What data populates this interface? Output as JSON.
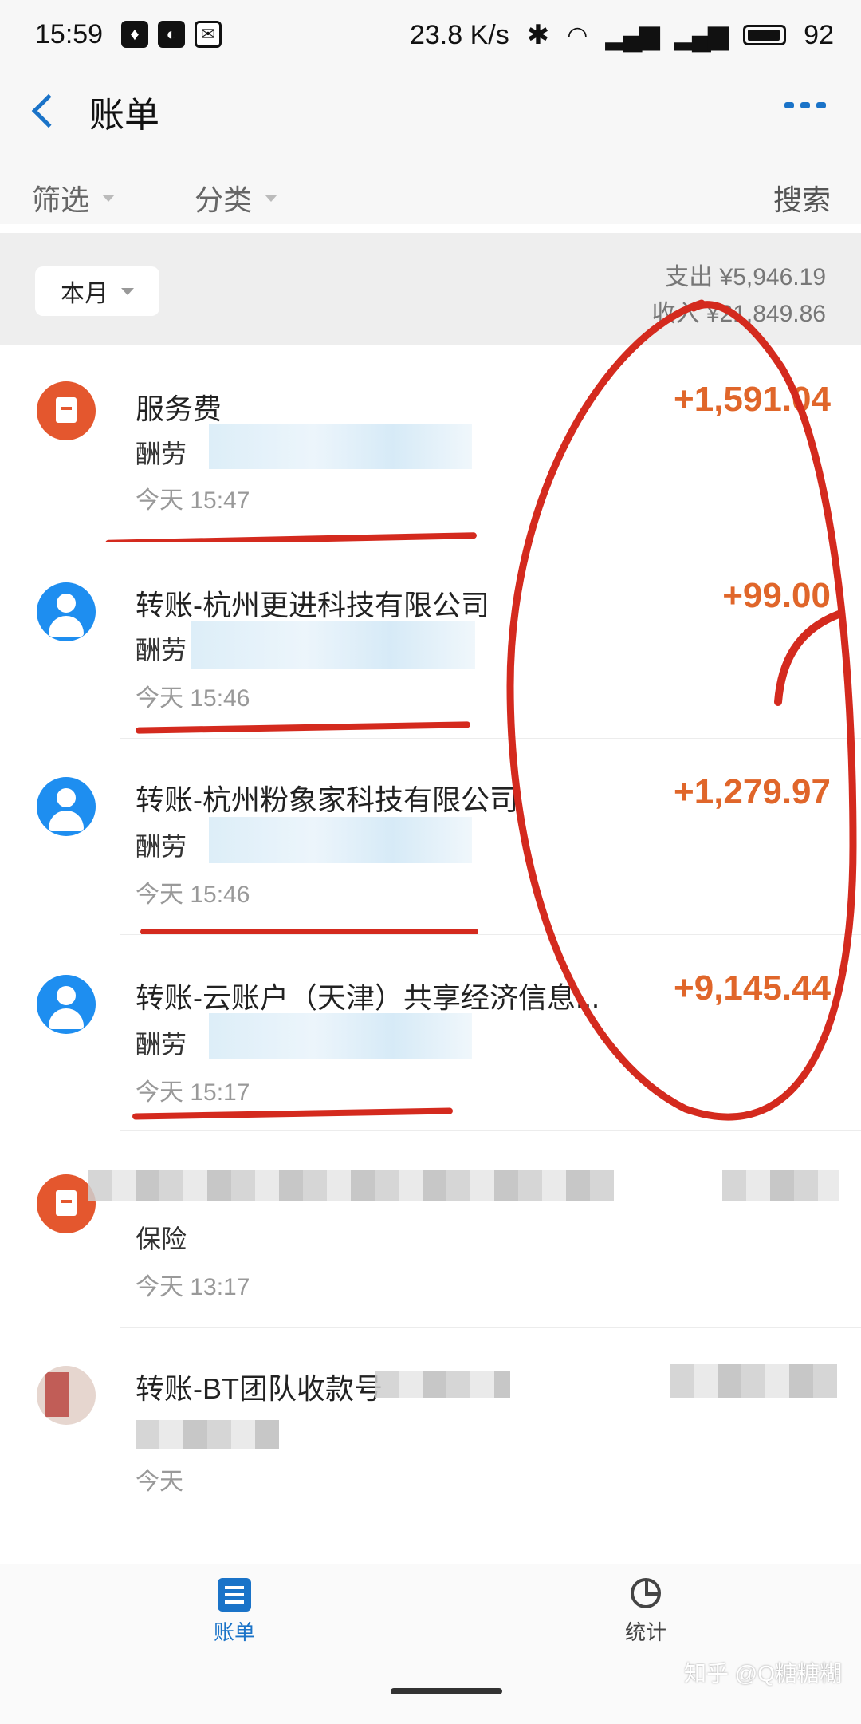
{
  "status_bar": {
    "time": "15:59",
    "icons": [
      "shield-icon",
      "app-icon",
      "chat-icon"
    ],
    "net_speed": "23.8 K/s",
    "battery": "92"
  },
  "header": {
    "title": "账单"
  },
  "filters": {
    "filter_label": "筛选",
    "category_label": "分类",
    "search_label": "搜索"
  },
  "summary": {
    "period": "本月",
    "expense": "支出 ¥5,946.19",
    "income": "收入 ¥21,849.86"
  },
  "transactions": [
    {
      "title": "服务费",
      "subtitle": "酬劳",
      "time": "今天  15:47",
      "amount": "+1,591.04",
      "icon": "red-envelope-icon"
    },
    {
      "title": "转账-杭州更进科技有限公司",
      "subtitle": "酬劳",
      "time": "今天  15:46",
      "amount": "+99.00",
      "icon": "user-icon"
    },
    {
      "title": "转账-杭州粉象家科技有限公司",
      "subtitle": "酬劳",
      "time": "今天  15:46",
      "amount": "+1,279.97",
      "icon": "user-icon"
    },
    {
      "title": "转账-云账户（天津）共享经济信息...",
      "subtitle": "酬劳",
      "time": "今天  15:17",
      "amount": "+9,145.44",
      "icon": "user-icon"
    },
    {
      "title": "",
      "subtitle": "保险",
      "time": "今天  13:17",
      "amount": "",
      "icon": "shop-icon"
    },
    {
      "title": "转账-BT团队收款号",
      "subtitle": "",
      "time": "今天",
      "amount": "",
      "icon": "photo-avatar"
    }
  ],
  "bottom_nav": {
    "bill_label": "账单",
    "stats_label": "统计",
    "active_color": "#1a73c8"
  },
  "watermark": "知乎 @Q糖糖糊",
  "colors": {
    "accent": "#1a73c8",
    "amount": "#e0662a",
    "annotation": "#d42a1e"
  }
}
